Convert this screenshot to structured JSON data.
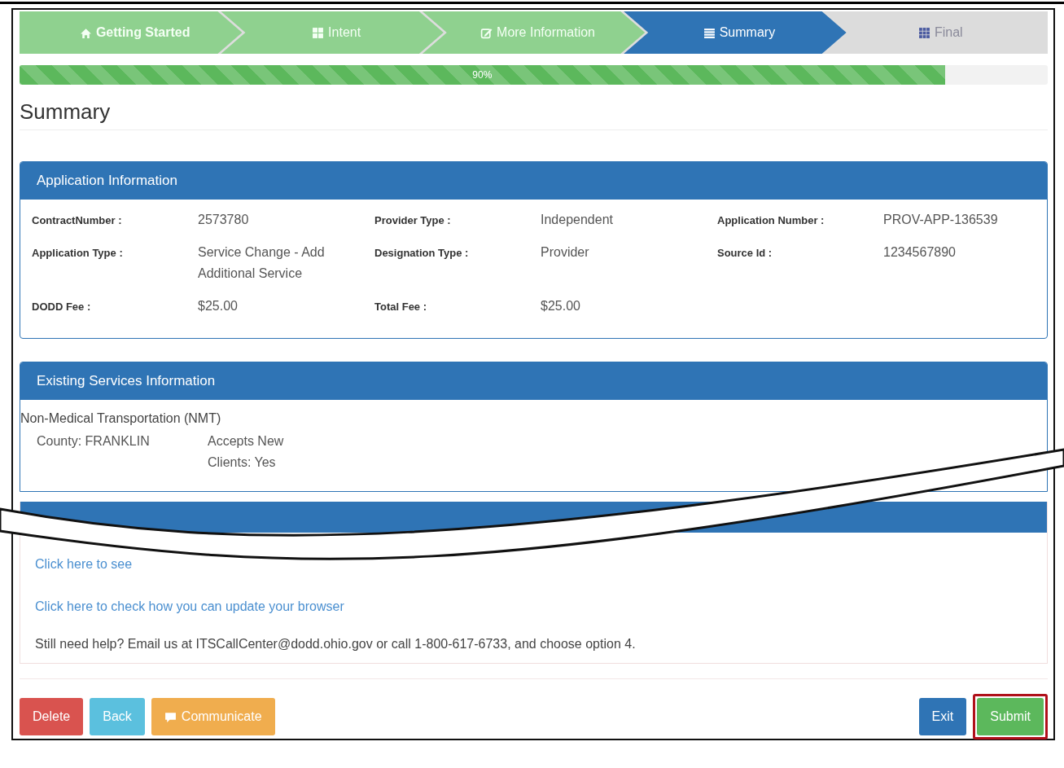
{
  "steps": [
    {
      "label": "Getting Started",
      "completed": true,
      "selected": false
    },
    {
      "label": "Intent",
      "completed": true,
      "selected": false
    },
    {
      "label": "More Information",
      "completed": true,
      "selected": false
    },
    {
      "label": "Summary",
      "completed": false,
      "selected": true
    },
    {
      "label": "Final",
      "completed": false,
      "selected": false
    }
  ],
  "progress": {
    "level": 0.9,
    "label": "90%"
  },
  "heading": "Summary",
  "application_panel": {
    "title": "Application Information",
    "fields": [
      {
        "label": "ContractNumber :",
        "value": "2573780"
      },
      {
        "label": "Provider Type :",
        "value": "Independent"
      },
      {
        "label": "Application Number :",
        "value": "PROV-APP-136539"
      },
      {
        "label": "Application Type :",
        "value": "Service Change - Add Additional Service"
      },
      {
        "label": "Designation Type :",
        "value": "Provider"
      },
      {
        "label": "Source Id :",
        "value": "1234567890"
      },
      {
        "label": "DODD Fee :",
        "value": "$25.00"
      },
      {
        "label": "Total Fee :",
        "value": "$25.00"
      }
    ]
  },
  "services_panel": {
    "title": "Existing Services Information",
    "service": "Non-Medical Transportation (NMT)",
    "county": "County: FRANKLIN",
    "accepts": "Accepts New Clients: Yes"
  },
  "links": [
    "Click here to see",
    "Click here to check how you can update your browser"
  ],
  "help_text": "Still need help? Email us at ITSCallCenter@dodd.ohio.gov or call 1-800-617-6733, and choose option 4.",
  "left_buttons": [
    {
      "label": "Delete",
      "kind": "danger",
      "highlighted": false
    },
    {
      "label": "Back",
      "kind": "info",
      "highlighted": false
    },
    {
      "label": "Communicate",
      "kind": "warning",
      "highlighted": false
    }
  ],
  "right_buttons": [
    {
      "label": "Exit",
      "kind": "primary",
      "highlighted": false
    },
    {
      "label": "Submit",
      "kind": "success",
      "highlighted": true
    }
  ]
}
